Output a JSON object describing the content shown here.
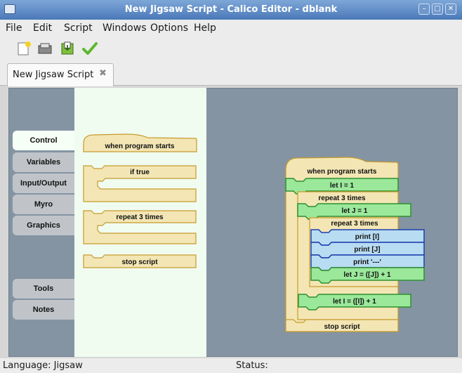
{
  "window": {
    "title": "New Jigsaw Script - Calico Editor - dblank"
  },
  "menu": [
    "File",
    "Edit",
    "Script",
    "Windows",
    "Options",
    "Help"
  ],
  "toolbar": {
    "icons": [
      "new-file-icon",
      "open-file-icon",
      "save-file-icon",
      "check-icon"
    ]
  },
  "tab": {
    "label": "New Jigsaw Script",
    "close": "✖"
  },
  "palette_tabs": [
    "Control",
    "Variables",
    "Input/Output",
    "Myro",
    "Graphics",
    "Tools",
    "Notes"
  ],
  "palette_blocks": {
    "when_start": "when program starts",
    "if_true": "if true",
    "repeat": "repeat 3 times",
    "stop": "stop script"
  },
  "script": {
    "when_start": "when program starts",
    "let_i": "let I = 1",
    "repeat_outer": "repeat 3 times",
    "let_j": "let J = 1",
    "repeat_inner": "repeat 3 times",
    "print_i": "print [I]",
    "print_j": "print [J]",
    "print_dash": "print '---'",
    "let_j_inc": "let J = ([J]) + 1",
    "let_i_inc": "let I = ([I]) + 1",
    "stop": "stop script"
  },
  "status": {
    "language": "Language: Jigsaw",
    "status": "Status:"
  },
  "colors": {
    "control": "#f3e6b4",
    "control_border": "#c79a2e",
    "variable": "#9be89b",
    "variable_border": "#2f8f2f",
    "io": "#b8dcf2",
    "io_border": "#1c3fae",
    "canvas": "#8494a3",
    "palette": "#f0fcf0"
  }
}
